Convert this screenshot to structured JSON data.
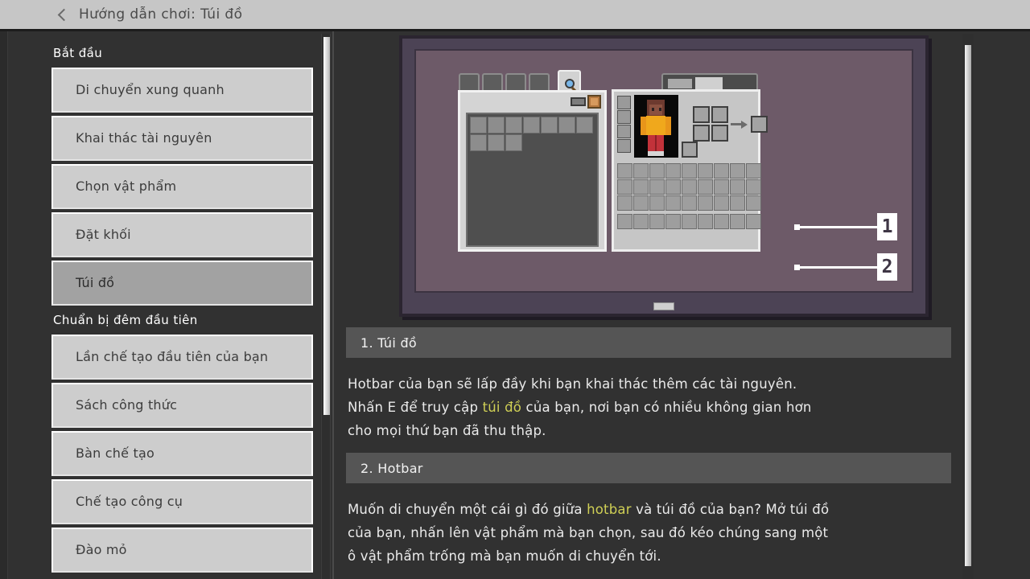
{
  "header": {
    "back_icon": "chevron-left-icon",
    "title": "Hướng dẫn chơi: Túi đồ"
  },
  "sidebar": {
    "sections": [
      {
        "title": "Bắt đầu",
        "items": [
          {
            "label": "Di chuyển xung quanh",
            "selected": false
          },
          {
            "label": "Khai thác tài nguyên",
            "selected": false
          },
          {
            "label": "Chọn vật phẩm",
            "selected": false
          },
          {
            "label": "Đặt khối",
            "selected": false
          },
          {
            "label": "Túi đồ",
            "selected": true
          }
        ]
      },
      {
        "title": "Chuẩn bị đêm đầu tiên",
        "items": [
          {
            "label": "Lần chế tạo đầu tiên của bạn",
            "selected": false
          },
          {
            "label": "Sách công thức",
            "selected": false
          },
          {
            "label": "Bàn chế tạo",
            "selected": false
          },
          {
            "label": "Chế tạo công cụ",
            "selected": false
          },
          {
            "label": "Đào mỏ",
            "selected": false
          }
        ]
      }
    ]
  },
  "illustration": {
    "name": "inventory-screen-illustration",
    "callouts": [
      {
        "id": "1",
        "label": "1"
      },
      {
        "id": "2",
        "label": "2"
      }
    ],
    "search_icon": "search-icon",
    "arrow_icon": "craft-arrow-icon",
    "background_color": "#6d5a68",
    "frame_color": "#4c4355"
  },
  "content": {
    "sections": [
      {
        "heading": "1. Túi đồ",
        "paragraph_parts": [
          {
            "text": "Hotbar của bạn sẽ lấp đầy khi bạn khai thác thêm các tài nguyên. Nhấn E để truy cập ",
            "highlight": false
          },
          {
            "text": "túi đồ",
            "highlight": true
          },
          {
            "text": " của bạn, nơi bạn có nhiều không gian hơn cho mọi thứ bạn đã thu thập.",
            "highlight": false
          }
        ]
      },
      {
        "heading": "2. Hotbar",
        "paragraph_parts": [
          {
            "text": "Muốn di chuyển một cái gì đó giữa ",
            "highlight": false
          },
          {
            "text": "hotbar",
            "highlight": true
          },
          {
            "text": " và túi đồ của bạn? Mở túi đồ của bạn, nhấn lên vật phẩm mà bạn chọn, sau đó kéo chúng sang một ô vật phẩm trống mà bạn muốn di chuyển tới.",
            "highlight": false
          }
        ]
      }
    ]
  },
  "scrollbars": {
    "sidebar_scroll_name": "sidebar-scrollbar",
    "content_scroll_name": "content-scrollbar"
  },
  "colors": {
    "header_bg": "#c6c6c6",
    "body_bg": "#313131",
    "item_bg": "#cdcdcd",
    "item_selected_bg": "#a2a2a2",
    "section_header_bg": "#555555",
    "highlight": "#d8d76a"
  }
}
